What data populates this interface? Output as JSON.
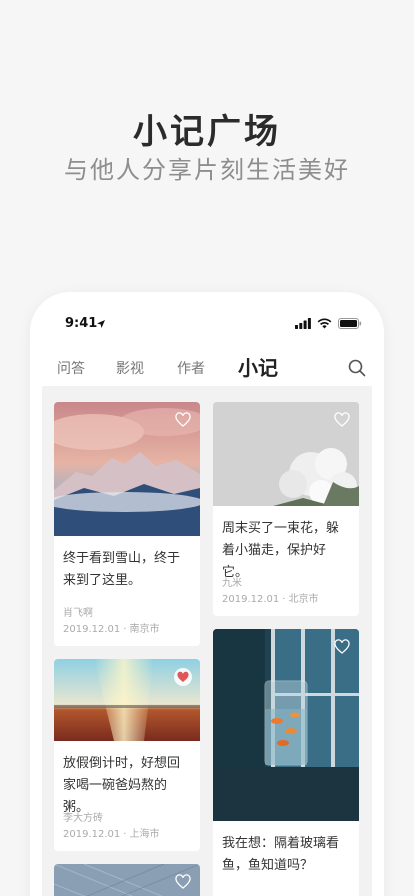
{
  "promo": {
    "title": "小记广场",
    "subtitle": "与他人分享片刻生活美好"
  },
  "status_bar": {
    "time": "9:41"
  },
  "nav": {
    "tabs": [
      {
        "label": "问答",
        "active": false
      },
      {
        "label": "影视",
        "active": false
      },
      {
        "label": "作者",
        "active": false
      },
      {
        "label": "小记",
        "active": true
      }
    ],
    "search_icon": "search-icon"
  },
  "cards": [
    {
      "text": "终于看到雪山，终于来到了这里。",
      "author": "肖飞啊",
      "date": "2019.12.01",
      "city": "南京市",
      "liked": false
    },
    {
      "text": "周末买了一束花，躲着小猫走，保护好它。",
      "author": "九米",
      "date": "2019.12.01",
      "city": "北京市",
      "liked": false
    },
    {
      "text": "放假倒计时，好想回家喝一碗爸妈熬的粥。",
      "author": "李大方砖",
      "date": "2019.12.01",
      "city": "上海市",
      "liked": true
    },
    {
      "text": "我在想：隔着玻璃看鱼，鱼知道吗？",
      "author": "",
      "date": "",
      "city": "",
      "liked": false
    },
    {
      "text": "",
      "author": "",
      "date": "",
      "city": "",
      "liked": false
    }
  ],
  "colors": {
    "accent_heart": "#e05555",
    "text_primary": "#222222",
    "text_muted": "#aaaaaa"
  }
}
